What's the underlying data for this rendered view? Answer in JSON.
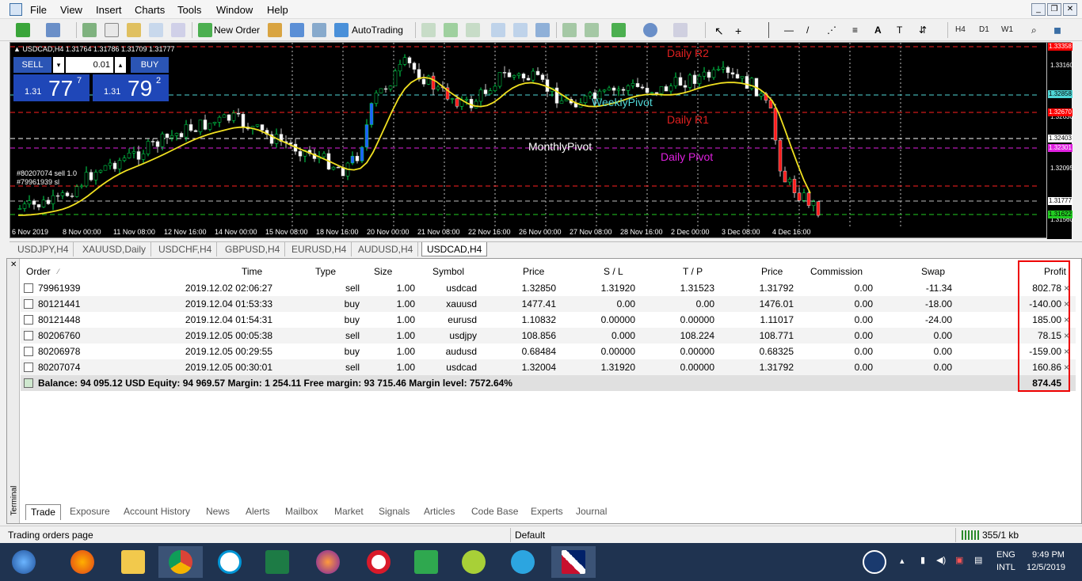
{
  "menubar": {
    "items": [
      "File",
      "View",
      "Insert",
      "Charts",
      "Tools",
      "Window",
      "Help"
    ]
  },
  "toolbar": {
    "new_order": "New Order",
    "autotrading": "AutoTrading",
    "timeframes": [
      "H4",
      "D1",
      "W1"
    ]
  },
  "chart": {
    "title": "▲ USDCAD,H4  1.31764 1.31786 1.31709 1.31777",
    "trade_panel": {
      "sell_label": "SELL",
      "buy_label": "BUY",
      "lot": "0.01",
      "sell_big": "1.31",
      "sell_digits": "77",
      "sell_sup": "7",
      "buy_big": "1.31",
      "buy_digits": "79",
      "buy_sup": "2"
    },
    "order_labels": [
      "#80207074 sell 1.0",
      "#79961939 sl"
    ],
    "pivots": {
      "daily_r2": "Daily R2",
      "weekly_pivot": "WeeklyPivot",
      "daily_r1": "Daily R1",
      "monthly_pivot": "MonthlyPivot",
      "daily_pivot": "Daily Pivot"
    },
    "price_scale": [
      "1.33160",
      "1.32630",
      "1.32095",
      "1.31560"
    ],
    "price_tags": [
      {
        "text": "1.33358",
        "color": "#ff0000"
      },
      {
        "text": "1.32858",
        "color": "#4fd6d6"
      },
      {
        "text": "1.32670",
        "color": "#ff0000"
      },
      {
        "text": "1.32403",
        "color": "#ffffff"
      },
      {
        "text": "1.32301",
        "color": "#e020e0"
      },
      {
        "text": "1.31777",
        "color": "#ffffff"
      },
      {
        "text": "1.31622",
        "color": "#22cc22"
      }
    ],
    "time_labels": [
      "6 Nov 2019",
      "8 Nov 00:00",
      "11 Nov 08:00",
      "12 Nov 16:00",
      "14 Nov 00:00",
      "15 Nov 08:00",
      "18 Nov 16:00",
      "20 Nov 00:00",
      "21 Nov 08:00",
      "22 Nov 16:00",
      "26 Nov 00:00",
      "27 Nov 08:00",
      "28 Nov 16:00",
      "2 Dec 00:00",
      "3 Dec 08:00",
      "4 Dec 16:00"
    ]
  },
  "symbol_tabs": [
    "USDJPY,H4",
    "XAUUSD,Daily",
    "USDCHF,H4",
    "GBPUSD,H4",
    "EURUSD,H4",
    "AUDUSD,H4",
    "USDCAD,H4"
  ],
  "terminal": {
    "side_label": "Terminal",
    "columns": [
      "Order",
      "Time",
      "Type",
      "Size",
      "Symbol",
      "Price",
      "S / L",
      "T / P",
      "Price",
      "Commission",
      "Swap",
      "Profit"
    ],
    "rows": [
      {
        "order": "79961939",
        "time": "2019.12.02 02:06:27",
        "type": "sell",
        "size": "1.00",
        "symbol": "usdcad",
        "price": "1.32850",
        "sl": "1.31920",
        "tp": "1.31523",
        "cur": "1.31792",
        "commission": "0.00",
        "swap": "-11.34",
        "profit": "802.78"
      },
      {
        "order": "80121441",
        "time": "2019.12.04 01:53:33",
        "type": "buy",
        "size": "1.00",
        "symbol": "xauusd",
        "price": "1477.41",
        "sl": "0.00",
        "tp": "0.00",
        "cur": "1476.01",
        "commission": "0.00",
        "swap": "-18.00",
        "profit": "-140.00"
      },
      {
        "order": "80121448",
        "time": "2019.12.04 01:54:31",
        "type": "buy",
        "size": "1.00",
        "symbol": "eurusd",
        "price": "1.10832",
        "sl": "0.00000",
        "tp": "0.00000",
        "cur": "1.11017",
        "commission": "0.00",
        "swap": "-24.00",
        "profit": "185.00"
      },
      {
        "order": "80206760",
        "time": "2019.12.05 00:05:38",
        "type": "sell",
        "size": "1.00",
        "symbol": "usdjpy",
        "price": "108.856",
        "sl": "0.000",
        "tp": "108.224",
        "cur": "108.771",
        "commission": "0.00",
        "swap": "0.00",
        "profit": "78.15"
      },
      {
        "order": "80206978",
        "time": "2019.12.05 00:29:55",
        "type": "buy",
        "size": "1.00",
        "symbol": "audusd",
        "price": "0.68484",
        "sl": "0.00000",
        "tp": "0.00000",
        "cur": "0.68325",
        "commission": "0.00",
        "swap": "0.00",
        "profit": "-159.00"
      },
      {
        "order": "80207074",
        "time": "2019.12.05 00:30:01",
        "type": "sell",
        "size": "1.00",
        "symbol": "usdcad",
        "price": "1.32004",
        "sl": "1.31920",
        "tp": "0.00000",
        "cur": "1.31792",
        "commission": "0.00",
        "swap": "0.00",
        "profit": "160.86"
      }
    ],
    "summary": "Balance: 94 095.12 USD  Equity: 94 969.57  Margin: 1 254.11  Free margin: 93 715.46  Margin level: 7572.64%",
    "summary_profit": "874.45",
    "tabs": [
      "Trade",
      "Exposure",
      "Account History",
      "News",
      "Alerts",
      "Mailbox",
      "Market",
      "Signals",
      "Articles",
      "Code Base",
      "Experts",
      "Journal"
    ]
  },
  "statusbar": {
    "left": "Trading orders page",
    "profile": "Default",
    "traffic": "355/1 kb"
  },
  "taskbar": {
    "lang1": "ENG",
    "lang2": "INTL",
    "time": "9:49 PM",
    "date": "12/5/2019"
  }
}
